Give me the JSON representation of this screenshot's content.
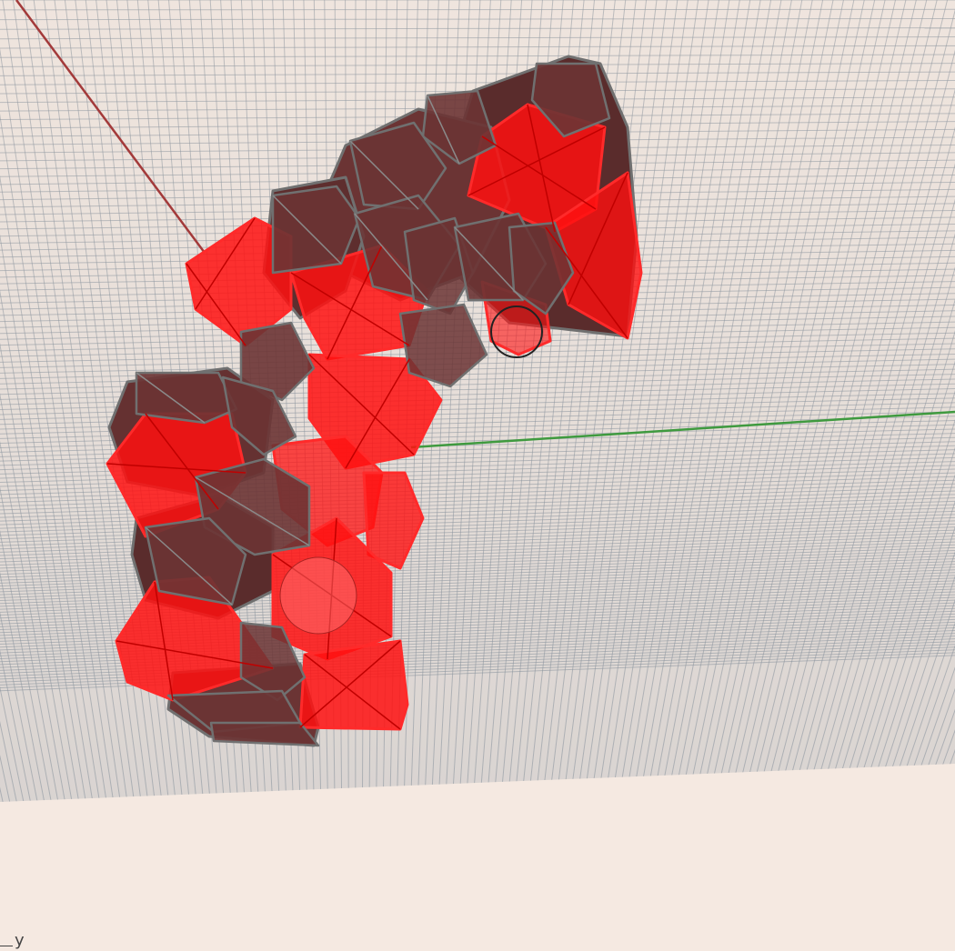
{
  "viewport": {
    "background": "#f5e9e1",
    "grid_color": "#7f8a96",
    "x_axis_color": "#a33a3a",
    "y_axis_color": "#3f9a3f",
    "mesh_face_dark": "#6b3434",
    "mesh_face_red": "#ff0000",
    "mesh_edge_gray": "#707070",
    "mesh_edge_red": "#ff2020"
  },
  "axis_indicator": {
    "label": "y",
    "icon": "axis-triad-icon"
  }
}
